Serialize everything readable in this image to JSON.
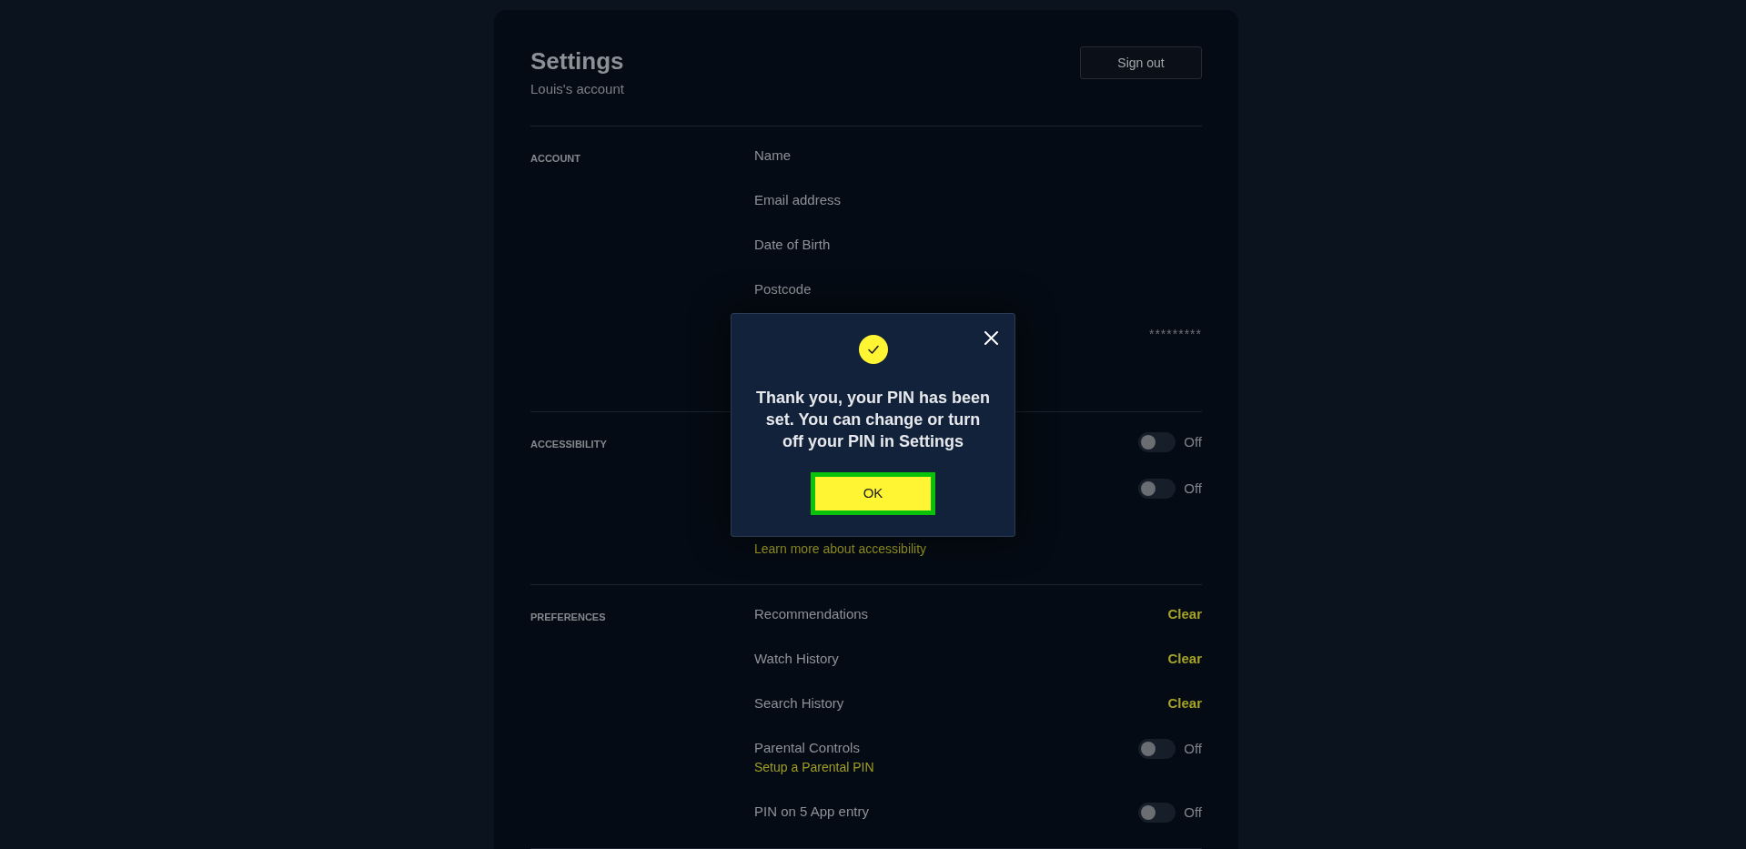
{
  "header": {
    "title": "Settings",
    "subtitle": "Louis's account",
    "sign_out_button": "Sign out"
  },
  "sections": [
    {
      "heading": "ACCOUNT",
      "rows": [
        {
          "kind": "text",
          "label": "Name"
        },
        {
          "kind": "text",
          "label": "Email address"
        },
        {
          "kind": "text",
          "label": "Date of Birth"
        },
        {
          "kind": "text",
          "label": "Postcode"
        },
        {
          "kind": "value",
          "value": "*********"
        }
      ]
    },
    {
      "heading": "ACCESSIBILITY",
      "rows": [
        {
          "kind": "toggle",
          "on": false,
          "state": "Off"
        },
        {
          "kind": "toggle",
          "on": false,
          "state": "Off"
        },
        {
          "kind": "link",
          "link": "Learn more about accessibility"
        }
      ]
    },
    {
      "heading": "PREFERENCES",
      "rows": [
        {
          "kind": "action",
          "label": "Recommendations",
          "action": "Clear"
        },
        {
          "kind": "action",
          "label": "Watch History",
          "action": "Clear"
        },
        {
          "kind": "action",
          "label": "Search History",
          "action": "Clear"
        },
        {
          "kind": "toggle",
          "label": "Parental Controls",
          "link": "Setup a Parental PIN",
          "on": false,
          "state": "Off"
        },
        {
          "kind": "toggle",
          "label": "PIN on 5 App entry",
          "on": false,
          "state": "Off"
        }
      ]
    }
  ],
  "dialog": {
    "message": "Thank you, your PIN has been set. You can change or turn off your PIN in Settings",
    "ok_button": {
      "label": "OK",
      "focused": true
    }
  }
}
